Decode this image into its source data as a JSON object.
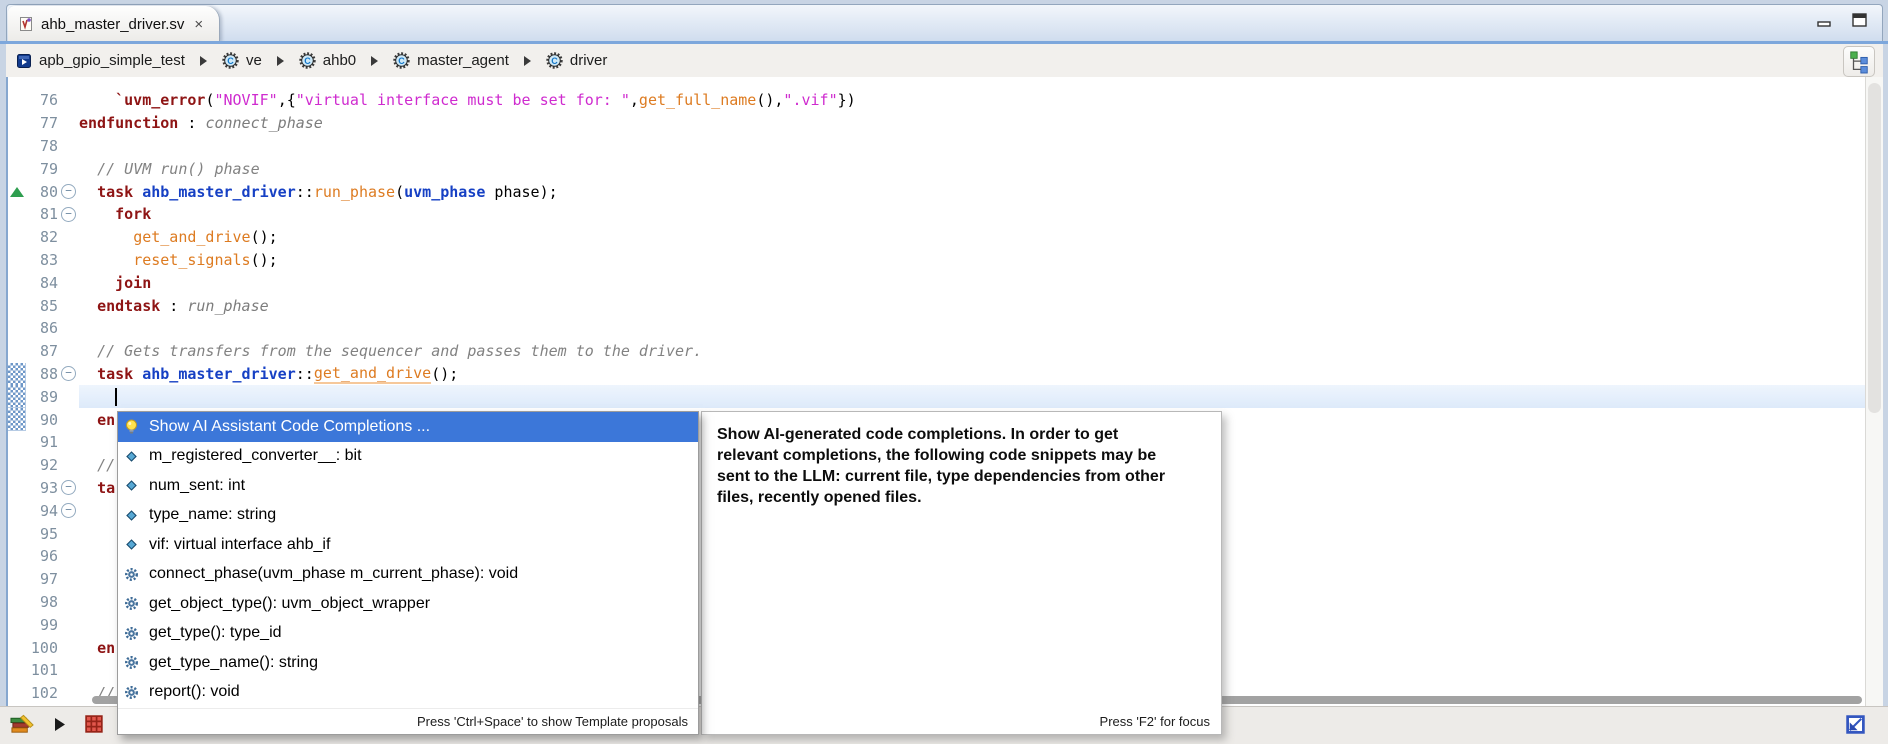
{
  "tab": {
    "title": "ahb_master_driver.sv",
    "close": "×"
  },
  "breadcrumb": {
    "items": [
      {
        "label": "apb_gpio_simple_test",
        "icon": "module-icon"
      },
      {
        "label": "ve",
        "icon": "class-icon"
      },
      {
        "label": "ahb0",
        "icon": "class-icon"
      },
      {
        "label": "master_agent",
        "icon": "class-icon"
      },
      {
        "label": "driver",
        "icon": "class-icon"
      }
    ]
  },
  "editor": {
    "lines": [
      {
        "num": "76",
        "segments": [
          [
            "    ",
            "p"
          ],
          [
            "`uvm_error",
            "kw"
          ],
          [
            "(",
            "p"
          ],
          [
            "\"NOVIF\"",
            "str"
          ],
          [
            ",{",
            "p"
          ],
          [
            "\"virtual interface must be set for: \"",
            "str"
          ],
          [
            ",",
            "p"
          ],
          [
            "get_full_name",
            "fn"
          ],
          [
            "(),",
            "p"
          ],
          [
            "\".vif\"",
            "str"
          ],
          [
            "})",
            "p"
          ]
        ]
      },
      {
        "num": "77",
        "segments": [
          [
            "endfunction",
            "kw"
          ],
          [
            " : ",
            "p"
          ],
          [
            "connect_phase",
            "lbl"
          ]
        ]
      },
      {
        "num": "78",
        "segments": []
      },
      {
        "num": "79",
        "segments": [
          [
            "  ",
            "p"
          ],
          [
            "// UVM run() phase",
            "cmt"
          ]
        ]
      },
      {
        "num": "80",
        "fold": true,
        "marker": "edit-arrow",
        "segments": [
          [
            "  ",
            "p"
          ],
          [
            "task",
            "kw"
          ],
          [
            " ",
            "p"
          ],
          [
            "ahb_master_driver",
            "typ"
          ],
          [
            "::",
            "p"
          ],
          [
            "run_phase",
            "fn"
          ],
          [
            "(",
            "p"
          ],
          [
            "uvm_phase",
            "typ"
          ],
          [
            " phase);",
            "p"
          ]
        ]
      },
      {
        "num": "81",
        "fold": true,
        "segments": [
          [
            "    ",
            "p"
          ],
          [
            "fork",
            "kw"
          ]
        ]
      },
      {
        "num": "82",
        "segments": [
          [
            "      ",
            "p"
          ],
          [
            "get_and_drive",
            "fn"
          ],
          [
            "();",
            "p"
          ]
        ]
      },
      {
        "num": "83",
        "segments": [
          [
            "      ",
            "p"
          ],
          [
            "reset_signals",
            "fn"
          ],
          [
            "();",
            "p"
          ]
        ]
      },
      {
        "num": "84",
        "segments": [
          [
            "    ",
            "p"
          ],
          [
            "join",
            "kw"
          ]
        ]
      },
      {
        "num": "85",
        "segments": [
          [
            "  ",
            "p"
          ],
          [
            "endtask",
            "kw"
          ],
          [
            " : ",
            "p"
          ],
          [
            "run_phase",
            "lbl"
          ]
        ]
      },
      {
        "num": "86",
        "segments": []
      },
      {
        "num": "87",
        "segments": [
          [
            "  ",
            "p"
          ],
          [
            "// Gets transfers from the sequencer and passes them to the driver.",
            "cmt"
          ]
        ]
      },
      {
        "num": "88",
        "fold": true,
        "range": true,
        "segments": [
          [
            "  ",
            "p"
          ],
          [
            "task",
            "kw"
          ],
          [
            " ",
            "p"
          ],
          [
            "ahb_master_driver",
            "typ"
          ],
          [
            "::",
            "p"
          ],
          [
            "get_and_drive",
            "fnu"
          ],
          [
            "();",
            "p"
          ]
        ]
      },
      {
        "num": "89",
        "range": true,
        "current": true,
        "caret": true,
        "segments": [
          [
            "    ",
            "p"
          ]
        ]
      },
      {
        "num": "90",
        "range": true,
        "segments": [
          [
            "  ",
            "p"
          ],
          [
            "en",
            "kw"
          ]
        ]
      },
      {
        "num": "91",
        "segments": []
      },
      {
        "num": "92",
        "segments": [
          [
            "  ",
            "p"
          ],
          [
            "//",
            "cmt"
          ]
        ]
      },
      {
        "num": "93",
        "fold": true,
        "segments": [
          [
            "  ",
            "p"
          ],
          [
            "ta",
            "kw"
          ]
        ]
      },
      {
        "num": "94",
        "fold": true,
        "segments": []
      },
      {
        "num": "95",
        "segments": []
      },
      {
        "num": "96",
        "segments": []
      },
      {
        "num": "97",
        "segments": []
      },
      {
        "num": "98",
        "segments": []
      },
      {
        "num": "99",
        "segments": []
      },
      {
        "num": "100",
        "segments": [
          [
            "  ",
            "p"
          ],
          [
            "en",
            "kw"
          ]
        ]
      },
      {
        "num": "101",
        "segments": []
      },
      {
        "num": "102",
        "segments": [
          [
            "  ",
            "p"
          ],
          [
            "//",
            "cmt"
          ]
        ]
      }
    ]
  },
  "completion_popup": {
    "items": [
      {
        "label": "Show AI Assistant Code Completions ...",
        "icon": "lightbulb-icon",
        "selected": true
      },
      {
        "label": "m_registered_converter__: bit",
        "icon": "field-icon"
      },
      {
        "label": "num_sent: int",
        "icon": "field-icon"
      },
      {
        "label": "type_name: string",
        "icon": "field-icon"
      },
      {
        "label": "vif: virtual interface ahb_if",
        "icon": "field-icon"
      },
      {
        "label": "connect_phase(uvm_phase m_current_phase): void",
        "icon": "method-icon"
      },
      {
        "label": "get_object_type(): uvm_object_wrapper",
        "icon": "method-icon"
      },
      {
        "label": "get_type(): type_id",
        "icon": "method-icon"
      },
      {
        "label": "get_type_name(): string",
        "icon": "method-icon"
      },
      {
        "label": "report(): void",
        "icon": "method-icon"
      }
    ],
    "footer": "Press 'Ctrl+Space' to show Template proposals"
  },
  "ai_tooltip": {
    "lines": [
      "Show AI-generated code completions. In order to get",
      "relevant completions, the following code snippets may be",
      "sent to the LLM: current file, type dependencies from other",
      "files, recently opened files."
    ],
    "footer": "Press 'F2' for focus"
  },
  "colors": {
    "selection_blue": "#3c77d9",
    "accent_line": "#7da7dc",
    "keyword": "#8e1414",
    "type": "#1640c4",
    "function": "#dd7b21",
    "string": "#cf2bcf",
    "comment": "#828282",
    "current_line": "#e8f1fb",
    "frame": "#c8d4e4"
  }
}
